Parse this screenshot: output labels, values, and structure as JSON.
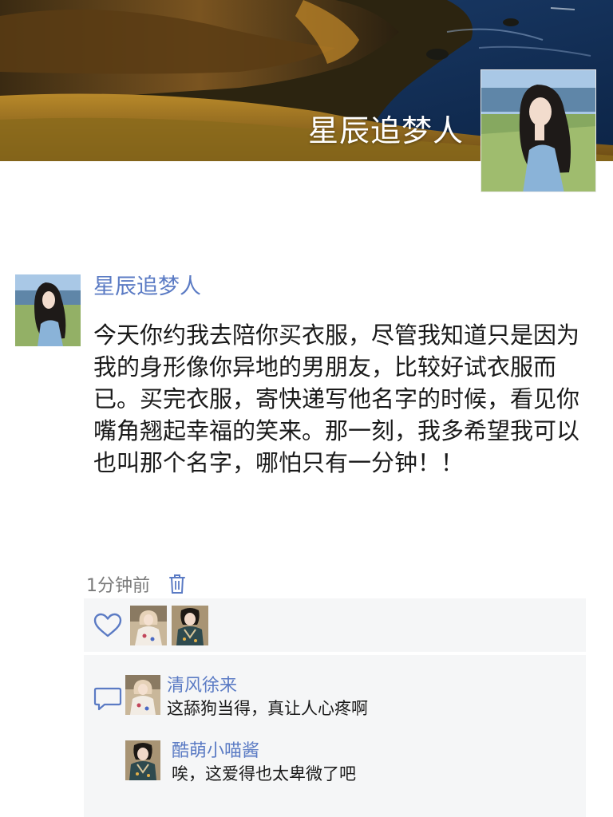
{
  "cover": {
    "name": "星辰追梦人",
    "image": "landscape-hills-coastline"
  },
  "post": {
    "author": "星辰追梦人",
    "avatar": "woman-in-field-avatar",
    "text": "今天你约我去陪你买衣服，尽管我知道只是因为我的身形像你异地的男朋友，比较好试衣服而已。买完衣服，寄快递写他名字的时候，看见你嘴角翘起幸福的笑来。那一刻，我多希望我可以也叫那个名字，哪怕只有一分钟！！",
    "time": "1分钟前",
    "delete_icon": "trash-icon"
  },
  "likes": {
    "icon": "heart-icon",
    "users": [
      "清风徐来",
      "酷萌小喵酱"
    ]
  },
  "comments_icon": "comment-bubble-icon",
  "comments": [
    {
      "name": "清风徐来",
      "text": "这舔狗当得，真让人心疼啊",
      "avatar": "girl-floral-dress-avatar"
    },
    {
      "name": "酷萌小喵酱",
      "text": "唉，这爱得也太卑微了吧",
      "avatar": "woman-qipao-avatar"
    }
  ],
  "colors": {
    "link_blue": "#5b7bc4",
    "panel_bg": "#f5f6f7",
    "muted_text": "#7a7a7a"
  }
}
